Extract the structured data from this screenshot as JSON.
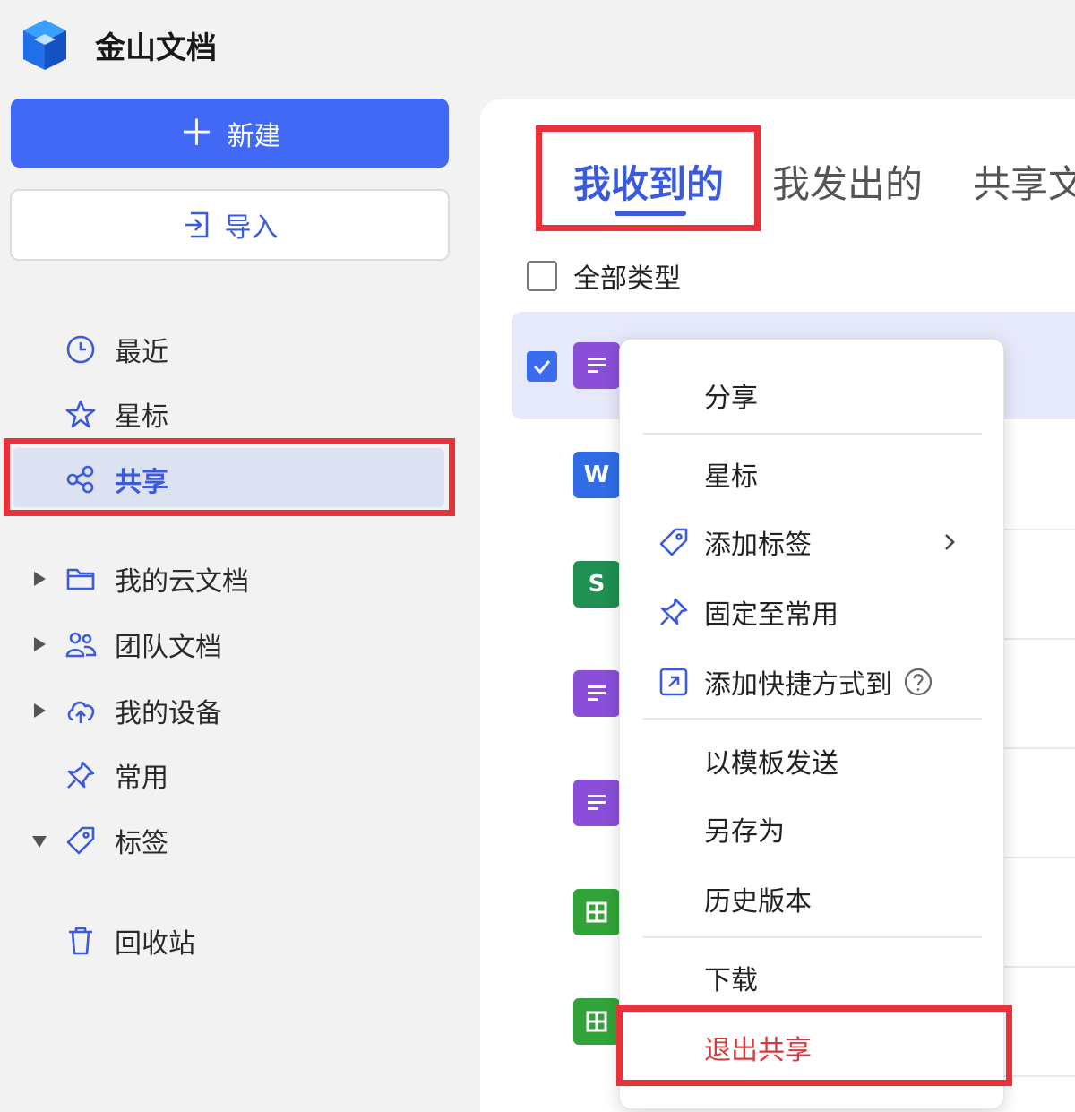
{
  "app": {
    "title": "金山文档"
  },
  "sidebar": {
    "new_button": "新建",
    "import_button": "导入",
    "nav": [
      {
        "label": "最近",
        "icon": "clock-icon"
      },
      {
        "label": "星标",
        "icon": "star-icon"
      },
      {
        "label": "共享",
        "icon": "share-nodes-icon",
        "active": true
      },
      {
        "label": "我的云文档",
        "icon": "folder-icon"
      },
      {
        "label": "团队文档",
        "icon": "team-icon"
      },
      {
        "label": "我的设备",
        "icon": "cloud-upload-icon"
      },
      {
        "label": "常用",
        "icon": "pin-icon"
      },
      {
        "label": "标签",
        "icon": "tag-icon"
      },
      {
        "label": "回收站",
        "icon": "trash-icon"
      }
    ]
  },
  "main": {
    "tabs": [
      {
        "label": "我收到的",
        "active": true
      },
      {
        "label": "我发出的"
      },
      {
        "label": "共享文"
      }
    ],
    "filter_label": "全部类型",
    "files": [
      {
        "type": "doc",
        "letter": ""
      },
      {
        "type": "word",
        "letter": "W"
      },
      {
        "type": "sheet",
        "letter": "S"
      },
      {
        "type": "doc",
        "letter": ""
      },
      {
        "type": "doc",
        "letter": ""
      },
      {
        "type": "table",
        "letter": ""
      },
      {
        "type": "table",
        "letter": ""
      }
    ]
  },
  "context_menu": {
    "items": {
      "share": "分享",
      "star": "星标",
      "add_tag": "添加标签",
      "pin": "固定至常用",
      "add_shortcut": "添加快捷方式到",
      "send_as_template": "以模板发送",
      "save_as": "另存为",
      "history": "历史版本",
      "download": "下载",
      "exit_share": "退出共享"
    }
  },
  "colors": {
    "accent": "#3b5bdb",
    "primary_button": "#4169f5",
    "highlight_box": "#e8313b",
    "danger_text": "#d63a3a"
  }
}
